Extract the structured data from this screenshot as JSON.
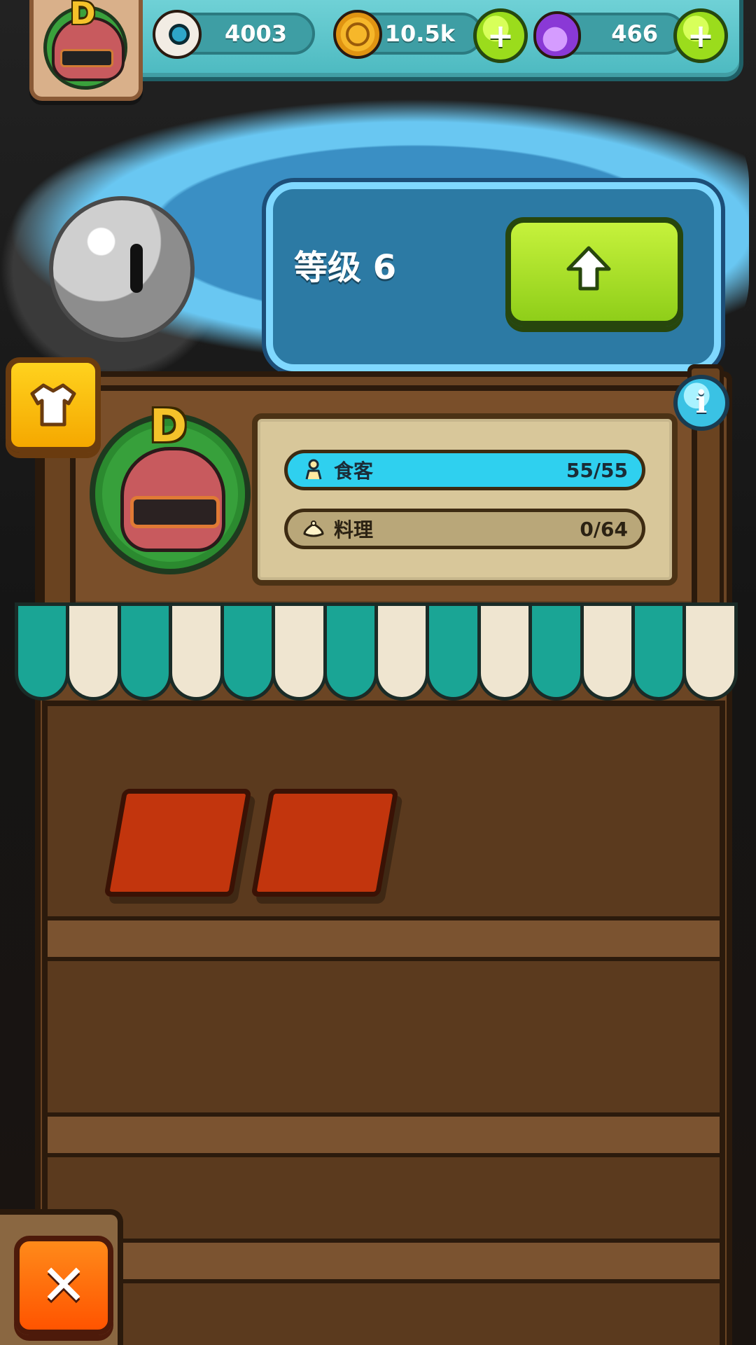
{
  "hud": {
    "eyeballs": "4003",
    "coins": "10.5k",
    "potions": "466",
    "icons": {
      "eyeballs": "eyeball-icon",
      "coins": "coin-icon",
      "potions": "potion-icon",
      "add": "plus-icon"
    },
    "add_coins_label": "+",
    "add_potions_label": "+"
  },
  "level": {
    "label": "等级 6"
  },
  "stall": {
    "info_label": "i",
    "guests_label": "食客",
    "guests_value": "55/55",
    "cooking_label": "料理",
    "cooking_value": "0/64"
  },
  "close_label": "✕",
  "colors": {
    "hud_teal": "#4cb9c0",
    "upgrade_green": "#8fce19",
    "guests_bar": "#2fd0ef",
    "cooking_bar": "#b9a779",
    "close_orange": "#ff5400",
    "shirt_yellow": "#f5a800"
  }
}
